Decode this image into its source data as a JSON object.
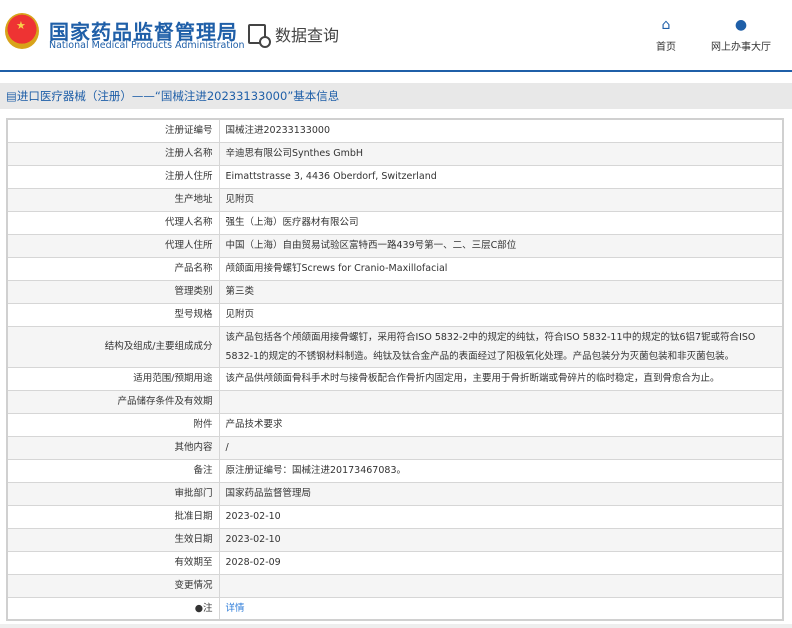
{
  "header": {
    "title_cn": "国家药品监督管理局",
    "title_en": "National Medical Products Administration",
    "query_label": "数据查询",
    "nav": [
      {
        "label": "首页",
        "icon": "home-icon"
      },
      {
        "label": "网上办事大厅",
        "icon": "user-icon"
      }
    ]
  },
  "section_title": "进口医疗器械（注册）——“国械注进20233133000”基本信息",
  "rows": [
    {
      "label": "注册证编号",
      "value": "国械注进20233133000"
    },
    {
      "label": "注册人名称",
      "value": "辛迪思有限公司Synthes GmbH"
    },
    {
      "label": "注册人住所",
      "value": "Eimattstrasse 3, 4436 Oberdorf, Switzerland"
    },
    {
      "label": "生产地址",
      "value": "见附页"
    },
    {
      "label": "代理人名称",
      "value": "强生（上海）医疗器材有限公司"
    },
    {
      "label": "代理人住所",
      "value": "中国（上海）自由贸易试验区富特西一路439号第一、二、三层C部位"
    },
    {
      "label": "产品名称",
      "value": "颅颌面用接骨螺钉Screws for Cranio-Maxillofacial"
    },
    {
      "label": "管理类别",
      "value": "第三类"
    },
    {
      "label": "型号规格",
      "value": "见附页"
    },
    {
      "label": "结构及组成/主要组成成分",
      "value": "该产品包括各个颅颌面用接骨螺钉，采用符合ISO 5832-2中的规定的纯钛，符合ISO 5832-11中的规定的钛6铝7铌或符合ISO 5832-1的规定的不锈钢材料制造。纯钛及钛合金产品的表面经过了阳极氧化处理。产品包装分为灭菌包装和非灭菌包装。"
    },
    {
      "label": "适用范围/预期用途",
      "value": "该产品供颅颌面骨科手术时与接骨板配合作骨折内固定用，主要用于骨折断端或骨碎片的临时稳定，直到骨愈合为止。"
    },
    {
      "label": "产品储存条件及有效期",
      "value": ""
    },
    {
      "label": "附件",
      "value": "产品技术要求"
    },
    {
      "label": "其他内容",
      "value": "/"
    },
    {
      "label": "备注",
      "value": "原注册证编号：国械注进20173467083。"
    },
    {
      "label": "审批部门",
      "value": "国家药品监督管理局"
    },
    {
      "label": "批准日期",
      "value": "2023-02-10"
    },
    {
      "label": "生效日期",
      "value": "2023-02-10"
    },
    {
      "label": "有效期至",
      "value": "2028-02-09"
    },
    {
      "label": "变更情况",
      "value": ""
    }
  ],
  "note": {
    "label": "注",
    "link": "详情"
  }
}
